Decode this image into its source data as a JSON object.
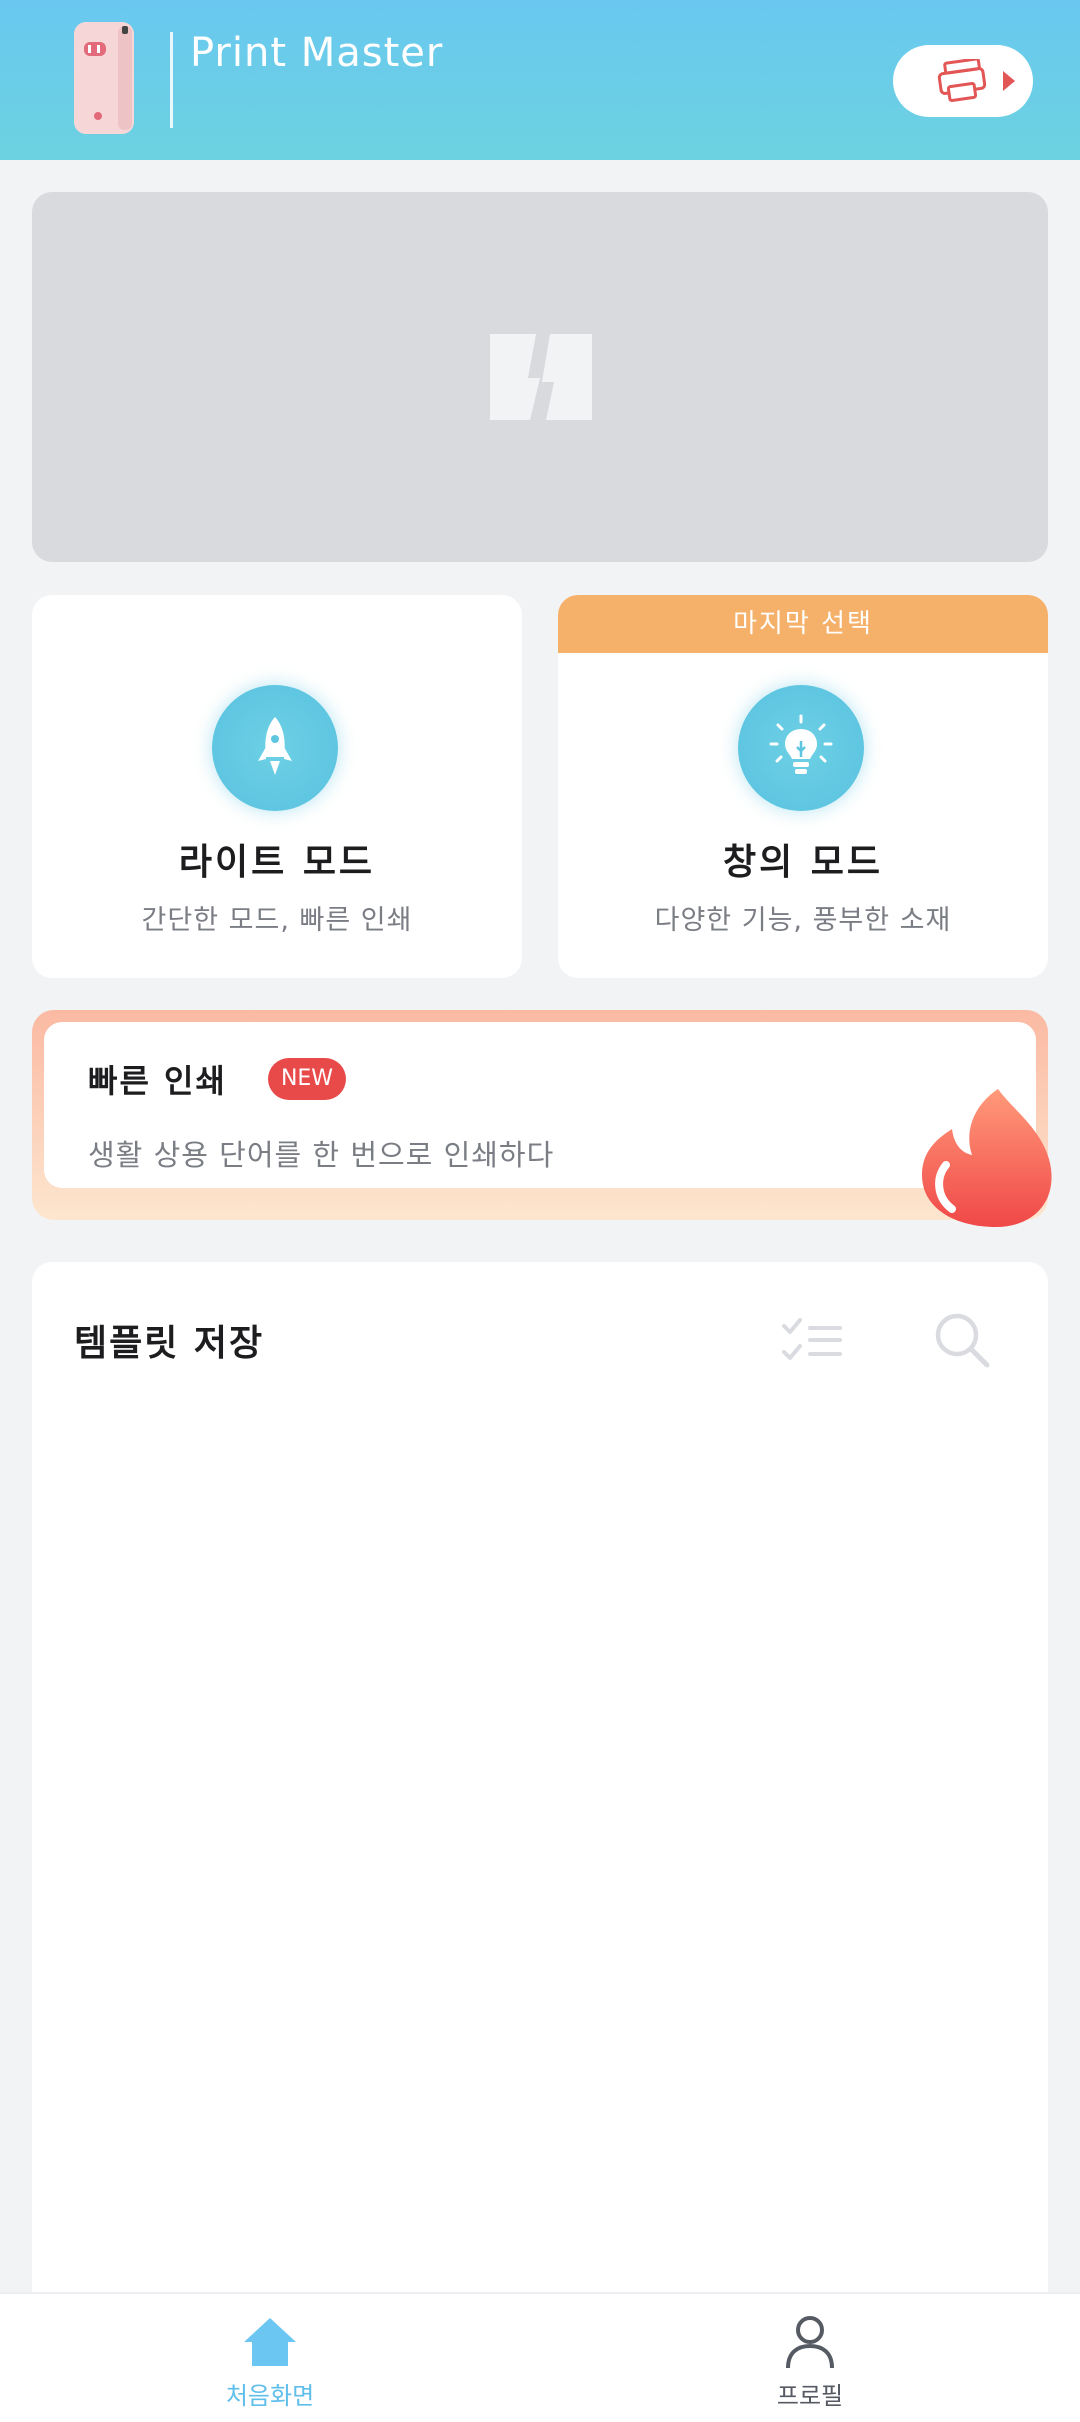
{
  "header": {
    "app_title": "Print Master",
    "device_icon": "printer-device-image",
    "connect_icon": "printer-icon",
    "colors": {
      "gradient_top": "#6ac8f0",
      "gradient_bottom": "#6cd2e0"
    }
  },
  "banner": {
    "icon": "image-placeholder-icon"
  },
  "modes": [
    {
      "title": "라이트 모드",
      "subtitle": "간단한 모드, 빠른 인쇄",
      "icon": "rocket-icon"
    },
    {
      "title": "창의 모드",
      "subtitle": "다양한 기능, 풍부한 소재",
      "icon": "lightbulb-icon",
      "badge": "마지막 선택"
    }
  ],
  "quick_print": {
    "title": "빠른 인쇄",
    "badge": "NEW",
    "description": "생활 상용 단어를 한 번으로 인쇄하다",
    "icon": "flame-icon"
  },
  "template": {
    "title": "템플릿 저장",
    "icons": [
      "checklist-icon",
      "search-icon"
    ]
  },
  "nav": {
    "home_label": "처음화면",
    "profile_label": "프로필",
    "active": "home",
    "colors": {
      "active": "#5fbfea",
      "inactive": "#555a63"
    }
  }
}
